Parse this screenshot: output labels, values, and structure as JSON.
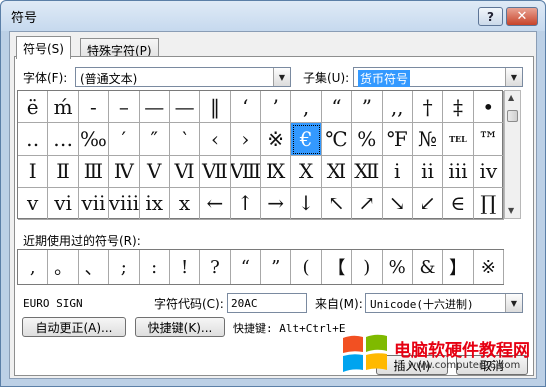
{
  "window": {
    "title": "符号",
    "help_label": "?",
    "close_label": "✕"
  },
  "tabs": [
    {
      "label": "符号(S)"
    },
    {
      "label": "特殊字符(P)"
    }
  ],
  "font": {
    "label": "字体(F):",
    "value": "(普通文本)"
  },
  "subset": {
    "label": "子集(U):",
    "value": "货币符号"
  },
  "grid_symbols": [
    "ë",
    "ḿ",
    "-",
    "–",
    "—",
    "—",
    "‖",
    "‘",
    "’",
    ",",
    "“",
    "”",
    ",,",
    "†",
    "‡",
    "•",
    "‥",
    "…",
    "‰",
    "′",
    "″",
    "‵",
    "‹",
    "›",
    "※",
    "€",
    "℃",
    "%",
    "℉",
    "№",
    "TEL",
    "™",
    "Ⅰ",
    "Ⅱ",
    "Ⅲ",
    "Ⅳ",
    "Ⅴ",
    "Ⅵ",
    "Ⅶ",
    "Ⅷ",
    "Ⅸ",
    "Ⅹ",
    "Ⅺ",
    "Ⅻ",
    "ⅰ",
    "ⅱ",
    "ⅲ",
    "ⅳ",
    "ⅴ",
    "ⅵ",
    "ⅶ",
    "ⅷ",
    "ⅸ",
    "ⅹ",
    "←",
    "↑",
    "→",
    "↓",
    "↖",
    "↗",
    "↘",
    "↙",
    "∈",
    "∏"
  ],
  "selected_index": 25,
  "recent": {
    "label": "近期使用过的符号(R):",
    "symbols": [
      ",",
      "。",
      "、",
      ";",
      ":",
      "!",
      "?",
      "“",
      "”",
      "(",
      "【",
      ")",
      "%",
      "&",
      "】",
      "※"
    ]
  },
  "char_name": "EURO SIGN",
  "char_code": {
    "label": "字符代码(C):",
    "value": "20AC"
  },
  "from": {
    "label": "来自(M):",
    "value": "Unicode(十六进制)"
  },
  "buttons": {
    "autocorrect": "自动更正(A)...",
    "shortcut_key": "快捷键(K)...",
    "insert": "插入(I)",
    "cancel": "取消"
  },
  "shortcut_text": "快捷键: Alt+Ctrl+E",
  "watermark": {
    "text": "电脑软硬件教程网",
    "url": "www.computer26.com",
    "colors": [
      "#f25022",
      "#7fba00",
      "#00a4ef",
      "#ffb900"
    ]
  }
}
